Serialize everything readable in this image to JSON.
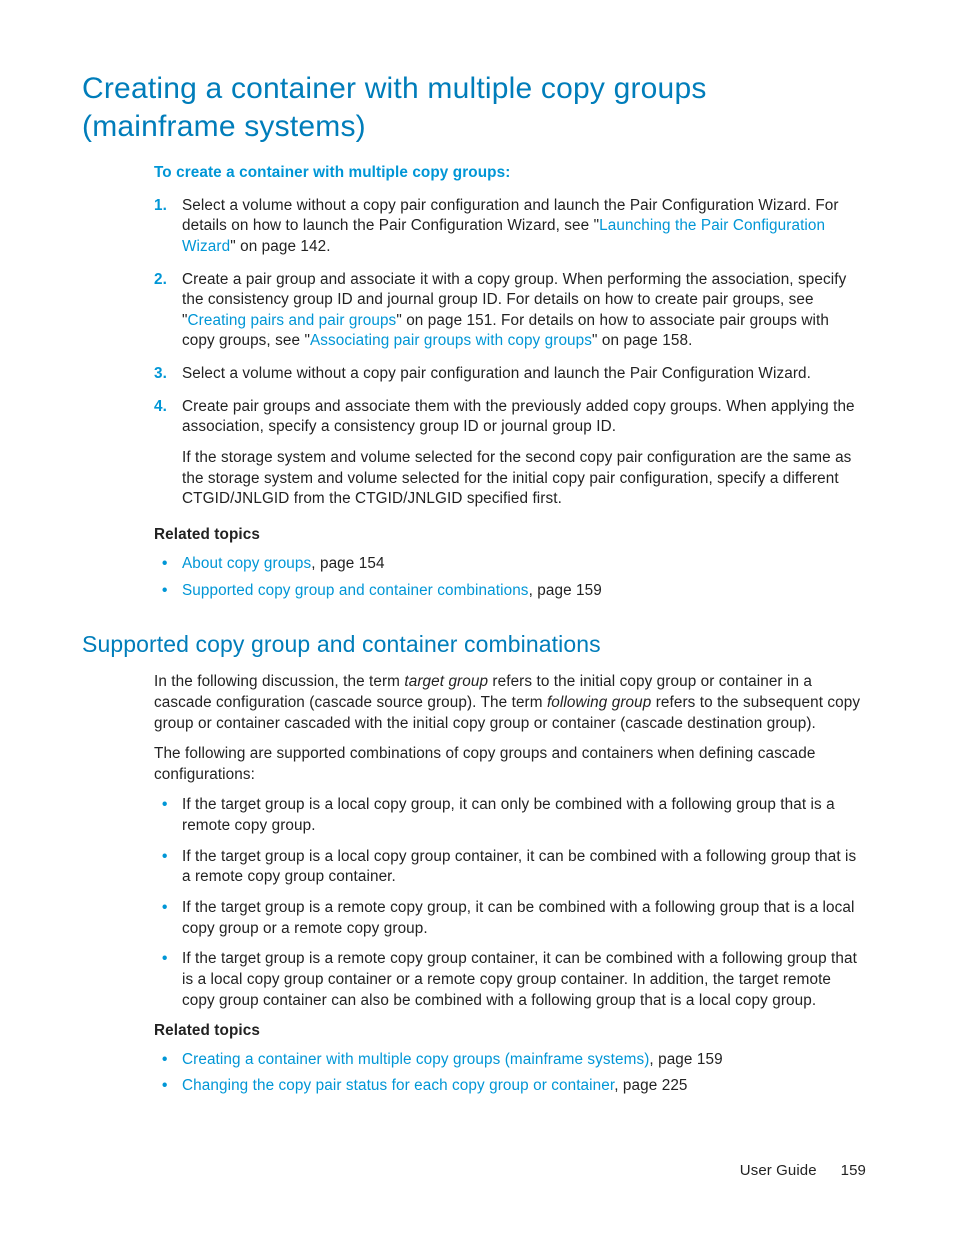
{
  "h1": "Creating a container with multiple copy groups (mainframe systems)",
  "intro": "To create a container with multiple copy groups:",
  "steps": {
    "s1a": "Select a volume without a copy pair configuration and launch the Pair Configuration Wizard. For details on how to launch the Pair Configuration Wizard, see \"",
    "s1link": "Launching the Pair Configuration Wizard",
    "s1b": "\" on page 142.",
    "s2a": "Create a pair group and associate it with a copy group. When performing the association, specify the consistency group ID and journal group ID. For details on how to create pair groups, see \"",
    "s2link1": "Creating pairs and pair groups",
    "s2b": "\" on page 151. For details on how to associate pair groups with copy groups, see \"",
    "s2link2": "Associating pair groups with copy groups",
    "s2c": "\" on page 158.",
    "s3": "Select a volume without a copy pair configuration and launch the Pair Configuration Wizard.",
    "s4": "Create pair groups and associate them with the previously added copy groups. When applying the association, specify a consistency group ID or journal group ID.",
    "s4extra": "If the storage system and volume selected for the second copy pair configuration are the same as the storage system and volume selected for the initial copy pair configuration, specify a different CTGID/JNLGID  from the CTGID/JNLGID specified first."
  },
  "related1": {
    "heading": "Related topics",
    "r1link": "About copy groups",
    "r1rest": ", page 154",
    "r2link": "Supported copy group and container combinations",
    "r2rest": ", page 159"
  },
  "h2": "Supported copy group and container combinations",
  "para1a": "In the following discussion, the term ",
  "para1i1": "target group",
  "para1b": " refers to the initial copy group or container in a cascade configuration (cascade source group). The term ",
  "para1i2": "following group",
  "para1c": " refers to the subsequent copy group or container cascaded with the initial copy group or container (cascade destination group).",
  "para2": "The following are supported combinations of copy groups and containers when defining cascade configurations:",
  "bullets2": {
    "b1": "If the target group is a local copy group, it can only be combined with a following group that is a remote copy group.",
    "b2": "If the target group is a local copy group container, it can be combined with a following group that is a remote copy group container.",
    "b3": "If the target group is a remote copy group, it can be combined with a following group that is a local copy group or a remote copy group.",
    "b4": "If the target group is a remote copy group container, it can be combined with a following group that is a local copy group container or a remote copy group container. In addition, the target remote copy group container can also be combined with a following group that is a local copy group."
  },
  "related2": {
    "heading": "Related topics",
    "r1link": "Creating a container with multiple copy groups (mainframe systems)",
    "r1rest": ", page 159",
    "r2link": "Changing the copy pair status for each copy group or container",
    "r2rest": ", page 225"
  },
  "footer": {
    "doc": "User Guide",
    "page": "159"
  }
}
